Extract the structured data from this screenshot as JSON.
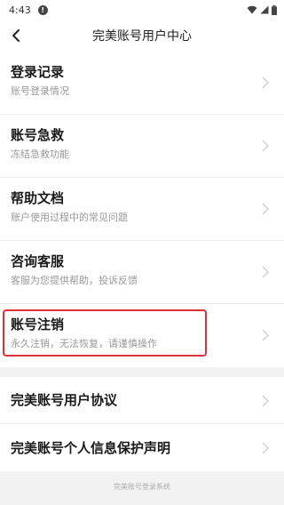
{
  "status": {
    "time": "4:43",
    "alert_glyph": "!",
    "icons": [
      "wifi-icon",
      "signal-icon",
      "battery-icon"
    ]
  },
  "nav": {
    "title": "完美账号用户中心",
    "back_icon": "chevron-left-icon"
  },
  "items": [
    {
      "title": "登录记录",
      "subtitle": "账号登录情况"
    },
    {
      "title": "账号急救",
      "subtitle": "冻结急救功能"
    },
    {
      "title": "帮助文档",
      "subtitle": "账户使用过程中的常见问题"
    },
    {
      "title": "咨询客服",
      "subtitle": "客服为您提供帮助，投诉反馈"
    },
    {
      "title": "账号注销",
      "subtitle": "永久注销，无法恢复，请谨慎操作",
      "highlighted": true
    }
  ],
  "links": [
    {
      "title": "完美账号用户协议"
    },
    {
      "title": "完美账号个人信息保护声明"
    }
  ],
  "footer": {
    "text": "完美账号登录系统"
  },
  "colors": {
    "highlight_border": "#e0303a",
    "background": "#f2f2f2"
  }
}
